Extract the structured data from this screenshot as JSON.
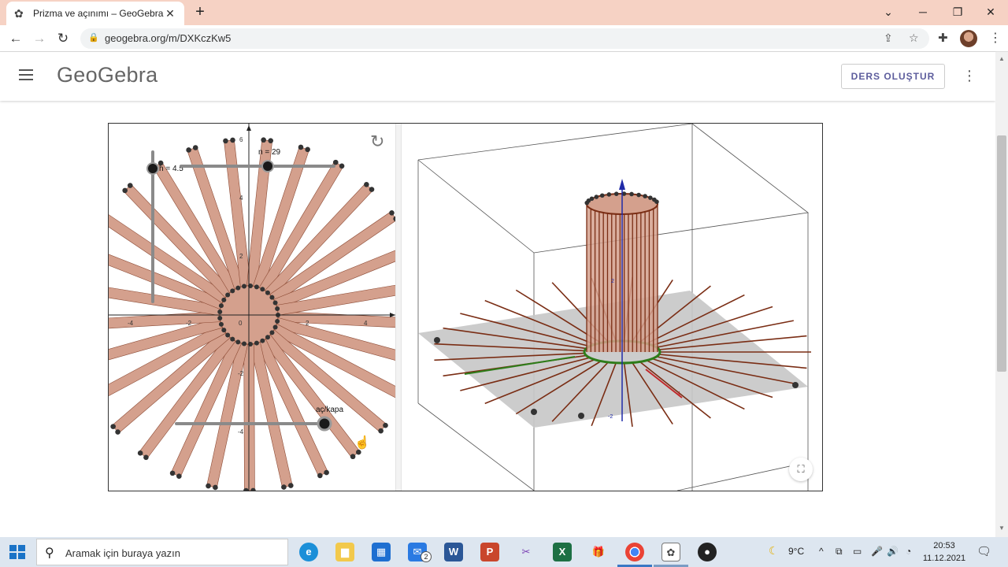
{
  "browser": {
    "tab_title": "Prizma ve açınımı – GeoGebra",
    "new_tab": "+",
    "url": "geogebra.org/m/DXKczKw5"
  },
  "site": {
    "logo": "GeoGebra",
    "create_lesson": "DERS OLUŞTUR"
  },
  "applet": {
    "sliders": {
      "h_label": "h = 4.5",
      "n_label": "n = 29",
      "toggle_label": "aç/kapa"
    },
    "axes_2d": {
      "x_ticks": [
        "-4",
        "-2",
        "0",
        "2",
        "4"
      ],
      "y_ticks": [
        "6",
        "4",
        "2",
        "-2",
        "-4"
      ]
    },
    "axes_3d": {
      "z_tick": "2",
      "neg_tick": "-2",
      "x_tick": "4"
    },
    "colors": {
      "faces": "#d4a08d",
      "edges": "#7a2d14",
      "base_circle": "#2e7d1a",
      "ground": "#c9c9c9"
    }
  },
  "taskbar": {
    "search_placeholder": "Aramak için buraya yazın",
    "mail_badge": "2",
    "weather": "9°C",
    "time": "20:53",
    "date": "11.12.2021"
  }
}
